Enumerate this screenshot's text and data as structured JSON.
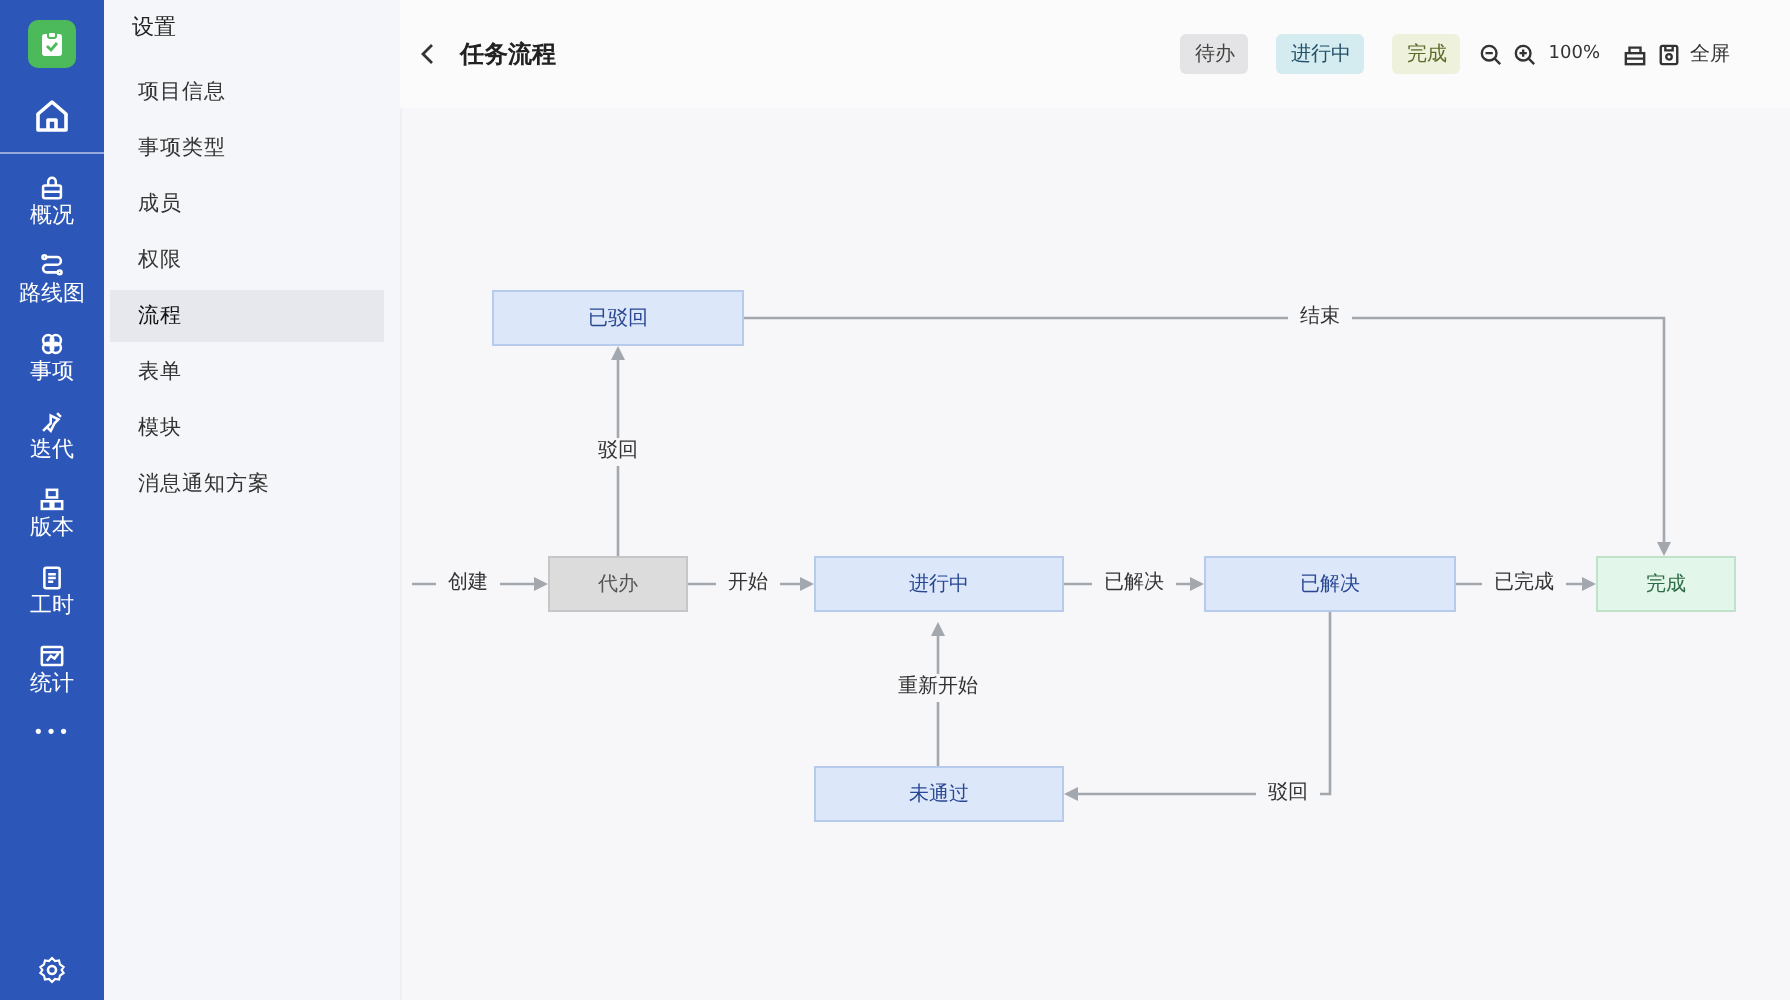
{
  "rail": {
    "items": [
      {
        "label": "概况"
      },
      {
        "label": "路线图"
      },
      {
        "label": "事项"
      },
      {
        "label": "迭代"
      },
      {
        "label": "版本"
      },
      {
        "label": "工时"
      },
      {
        "label": "统计"
      }
    ],
    "more": "•••"
  },
  "settings_nav": {
    "title": "设置",
    "items": [
      {
        "label": "项目信息",
        "selected": false
      },
      {
        "label": "事项类型",
        "selected": false
      },
      {
        "label": "成员",
        "selected": false
      },
      {
        "label": "权限",
        "selected": false
      },
      {
        "label": "流程",
        "selected": true
      },
      {
        "label": "表单",
        "selected": false
      },
      {
        "label": "模块",
        "selected": false
      },
      {
        "label": "消息通知方案",
        "selected": false
      }
    ]
  },
  "header": {
    "title": "任务流程",
    "legend": [
      {
        "label": "待办",
        "kind": "todo"
      },
      {
        "label": "进行中",
        "kind": "progress"
      },
      {
        "label": "完成",
        "kind": "done"
      }
    ],
    "zoom": "100%",
    "fullscreen": "全屏"
  },
  "flow": {
    "nodes": [
      {
        "label": "已驳回",
        "kind": "progress"
      },
      {
        "label": "代办",
        "kind": "todo"
      },
      {
        "label": "进行中",
        "kind": "progress"
      },
      {
        "label": "已解决",
        "kind": "progress"
      },
      {
        "label": "完成",
        "kind": "done"
      },
      {
        "label": "未通过",
        "kind": "progress"
      }
    ],
    "edges": [
      {
        "label": "创建"
      },
      {
        "label": "开始"
      },
      {
        "label": "已解决"
      },
      {
        "label": "已完成"
      },
      {
        "label": "驳回"
      },
      {
        "label": "结束"
      },
      {
        "label": "重新开始"
      },
      {
        "label": "驳回"
      }
    ]
  }
}
